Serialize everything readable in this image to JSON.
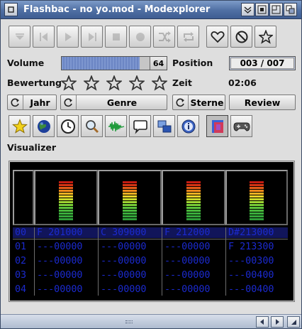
{
  "window": {
    "title": "Flashbac - no yo.mod - Modexplorer"
  },
  "labels": {
    "volume": "Volume",
    "position": "Position",
    "rating": "Bewertung",
    "time": "Zeit",
    "visualizer": "Visualizer"
  },
  "volume": {
    "value": "64",
    "fraction": 0.74
  },
  "position": {
    "value": "003 / 007"
  },
  "time": {
    "value": "02:06"
  },
  "rating": {
    "stars": 5,
    "filled": 0
  },
  "buttons": {
    "year": "Jahr",
    "genre": "Genre",
    "stars": "Sterne",
    "review": "Review"
  },
  "toolbar": [
    "eject-icon",
    "previous-icon",
    "play-icon",
    "next-icon",
    "stop-icon",
    "record-icon",
    "shuffle-icon",
    "repeat-icon",
    "heart-icon",
    "block-icon",
    "star-icon"
  ],
  "tabs": [
    "star-tab",
    "globe-tab",
    "clock-tab",
    "search-tab",
    "waveform-tab",
    "comment-tab",
    "windows-tab",
    "info-tab",
    "visualizer-tab",
    "gamepad-tab"
  ],
  "colors": {
    "pattern_text": "#1b2acf",
    "current_row": "#11155a",
    "title_bar": "#4f6fa3"
  },
  "visualizer": {
    "rows": [
      {
        "num": "00",
        "cells": [
          "F 201000",
          "C 309000",
          "F 212000",
          "D#213000"
        ]
      },
      {
        "num": "01",
        "cells": [
          "---00000",
          "---00000",
          "---00000",
          "F 213300"
        ]
      },
      {
        "num": "02",
        "cells": [
          "---00000",
          "---00000",
          "---00000",
          "---00300"
        ]
      },
      {
        "num": "03",
        "cells": [
          "---00000",
          "---00000",
          "---00000",
          "---00400"
        ]
      },
      {
        "num": "04",
        "cells": [
          "---00000",
          "---00000",
          "---00000",
          "---00400"
        ]
      }
    ]
  }
}
